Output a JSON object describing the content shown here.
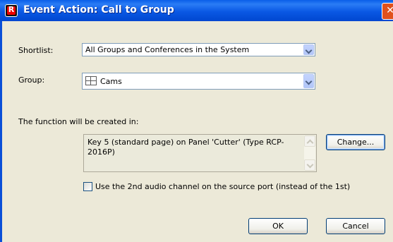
{
  "window": {
    "title": "Event Action: Call to Group",
    "app_icon_letter": "R",
    "close_glyph": "✕"
  },
  "shortlist": {
    "label": "Shortlist:",
    "value": "All Groups and Conferences in the System"
  },
  "group": {
    "label": "Group:",
    "value": "Cams",
    "icon": "group-grid-icon"
  },
  "function_location": {
    "label": "The function will be created in:",
    "text": "Key 5 (standard page) on Panel 'Cutter' (Type RCP-2016P)",
    "change_button": "Change..."
  },
  "audio_option": {
    "label": "Use the 2nd audio channel on the source port (instead of the 1st)",
    "checked": false
  },
  "buttons": {
    "ok": "OK",
    "cancel": "Cancel"
  }
}
